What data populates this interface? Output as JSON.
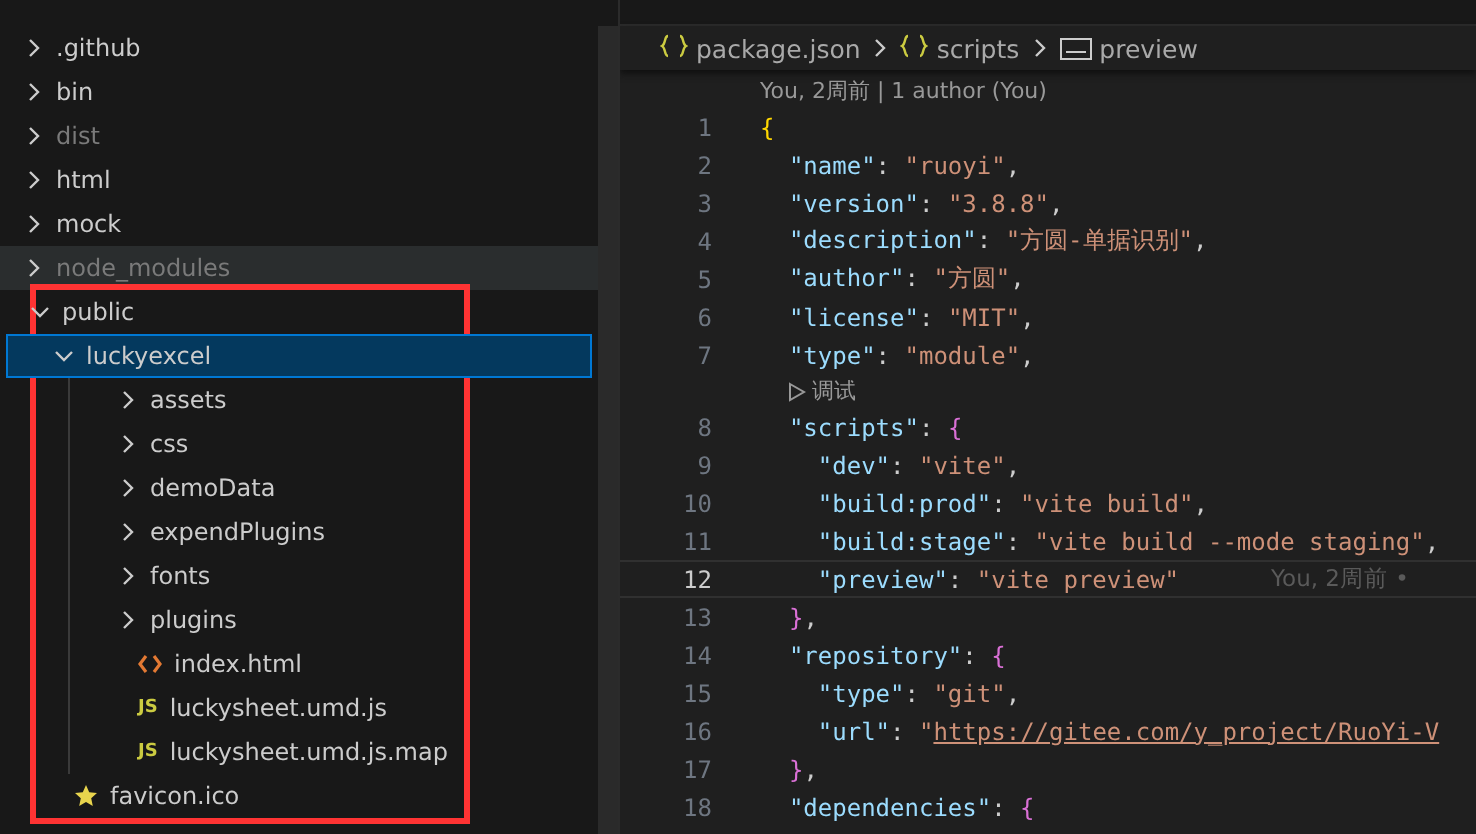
{
  "explorer": {
    "items": [
      {
        "name": ".github",
        "kind": "folder",
        "expanded": false,
        "ignored": false,
        "hovered": false,
        "selected": false,
        "outlined": false
      },
      {
        "name": "bin",
        "kind": "folder",
        "expanded": false,
        "ignored": false,
        "hovered": false,
        "selected": false,
        "outlined": false
      },
      {
        "name": "dist",
        "kind": "folder",
        "expanded": false,
        "ignored": true,
        "hovered": false,
        "selected": false,
        "outlined": false
      },
      {
        "name": "html",
        "kind": "folder",
        "expanded": false,
        "ignored": false,
        "hovered": false,
        "selected": false,
        "outlined": false
      },
      {
        "name": "mock",
        "kind": "folder",
        "expanded": false,
        "ignored": false,
        "hovered": false,
        "selected": false,
        "outlined": false
      },
      {
        "name": "node_modules",
        "kind": "folder",
        "expanded": false,
        "ignored": true,
        "hovered": true,
        "selected": false,
        "outlined": false
      },
      {
        "name": "public",
        "kind": "folder",
        "expanded": true,
        "ignored": false,
        "hovered": false,
        "selected": false,
        "outlined": true,
        "children": [
          {
            "name": "luckyexcel",
            "kind": "folder",
            "expanded": true,
            "ignored": false,
            "hovered": false,
            "selected": true,
            "outlined": false,
            "children": [
              {
                "name": "assets",
                "kind": "folder",
                "expanded": false,
                "ignored": false,
                "hovered": false,
                "selected": false,
                "outlined": false
              },
              {
                "name": "css",
                "kind": "folder",
                "expanded": false,
                "ignored": false,
                "hovered": false,
                "selected": false,
                "outlined": false
              },
              {
                "name": "demoData",
                "kind": "folder",
                "expanded": false,
                "ignored": false,
                "hovered": false,
                "selected": false,
                "outlined": false
              },
              {
                "name": "expendPlugins",
                "kind": "folder",
                "expanded": false,
                "ignored": false,
                "hovered": false,
                "selected": false,
                "outlined": false
              },
              {
                "name": "fonts",
                "kind": "folder",
                "expanded": false,
                "ignored": false,
                "hovered": false,
                "selected": false,
                "outlined": false
              },
              {
                "name": "plugins",
                "kind": "folder",
                "expanded": false,
                "ignored": false,
                "hovered": false,
                "selected": false,
                "outlined": false
              },
              {
                "name": "index.html",
                "kind": "html",
                "ignored": false,
                "hovered": false,
                "selected": false,
                "outlined": false
              },
              {
                "name": "luckysheet.umd.js",
                "kind": "js",
                "icon_text": "JS",
                "ignored": false,
                "hovered": false,
                "selected": false,
                "outlined": false
              },
              {
                "name": "luckysheet.umd.js.map",
                "kind": "js",
                "icon_text": "JS",
                "ignored": false,
                "hovered": false,
                "selected": false,
                "outlined": false
              }
            ]
          },
          {
            "name": "favicon.ico",
            "kind": "star",
            "ignored": false,
            "hovered": false,
            "selected": false,
            "outlined": false
          }
        ]
      }
    ]
  },
  "breadcrumb": [
    {
      "kind": "braces",
      "text": "package.json"
    },
    {
      "kind": "braces",
      "text": "scripts"
    },
    {
      "kind": "string",
      "text": "preview"
    }
  ],
  "editor": {
    "lines": [
      {
        "kind": "lens",
        "text": "You, 2周前 | 1 author (You)"
      },
      {
        "kind": "code",
        "number": "1",
        "current": false,
        "tokens": [
          {
            "kind": "brace1",
            "text": "{"
          }
        ]
      },
      {
        "kind": "code",
        "number": "2",
        "current": false,
        "tokens": [
          {
            "kind": "key",
            "text": "  \"name\""
          },
          {
            "kind": "punct",
            "text": ": "
          },
          {
            "kind": "str",
            "text": "\"ruoyi\""
          },
          {
            "kind": "punct",
            "text": ","
          }
        ]
      },
      {
        "kind": "code",
        "number": "3",
        "current": false,
        "tokens": [
          {
            "kind": "key",
            "text": "  \"version\""
          },
          {
            "kind": "punct",
            "text": ": "
          },
          {
            "kind": "str",
            "text": "\"3.8.8\""
          },
          {
            "kind": "punct",
            "text": ","
          }
        ]
      },
      {
        "kind": "code",
        "number": "4",
        "current": false,
        "tokens": [
          {
            "kind": "key",
            "text": "  \"description\""
          },
          {
            "kind": "punct",
            "text": ": "
          },
          {
            "kind": "str",
            "text": "\"方圆-单据识别\""
          },
          {
            "kind": "punct",
            "text": ","
          }
        ]
      },
      {
        "kind": "code",
        "number": "5",
        "current": false,
        "tokens": [
          {
            "kind": "key",
            "text": "  \"author\""
          },
          {
            "kind": "punct",
            "text": ": "
          },
          {
            "kind": "str",
            "text": "\"方圆\""
          },
          {
            "kind": "punct",
            "text": ","
          }
        ]
      },
      {
        "kind": "code",
        "number": "6",
        "current": false,
        "tokens": [
          {
            "kind": "key",
            "text": "  \"license\""
          },
          {
            "kind": "punct",
            "text": ": "
          },
          {
            "kind": "str",
            "text": "\"MIT\""
          },
          {
            "kind": "punct",
            "text": ","
          }
        ]
      },
      {
        "kind": "code",
        "number": "7",
        "current": false,
        "tokens": [
          {
            "kind": "key",
            "text": "  \"type\""
          },
          {
            "kind": "punct",
            "text": ": "
          },
          {
            "kind": "str",
            "text": "\"module\""
          },
          {
            "kind": "punct",
            "text": ","
          }
        ]
      },
      {
        "kind": "debug",
        "text": "调试"
      },
      {
        "kind": "code",
        "number": "8",
        "current": false,
        "tokens": [
          {
            "kind": "key",
            "text": "  \"scripts\""
          },
          {
            "kind": "punct",
            "text": ": "
          },
          {
            "kind": "brace2",
            "text": "{"
          }
        ]
      },
      {
        "kind": "code",
        "number": "9",
        "current": false,
        "tokens": [
          {
            "kind": "key",
            "text": "    \"dev\""
          },
          {
            "kind": "punct",
            "text": ": "
          },
          {
            "kind": "str",
            "text": "\"vite\""
          },
          {
            "kind": "punct",
            "text": ","
          }
        ]
      },
      {
        "kind": "code",
        "number": "10",
        "current": false,
        "tokens": [
          {
            "kind": "key",
            "text": "    \"build:prod\""
          },
          {
            "kind": "punct",
            "text": ": "
          },
          {
            "kind": "str",
            "text": "\"vite build\""
          },
          {
            "kind": "punct",
            "text": ","
          }
        ]
      },
      {
        "kind": "code",
        "number": "11",
        "current": false,
        "tokens": [
          {
            "kind": "key",
            "text": "    \"build:stage\""
          },
          {
            "kind": "punct",
            "text": ": "
          },
          {
            "kind": "str",
            "text": "\"vite build --mode staging\""
          },
          {
            "kind": "punct",
            "text": ","
          }
        ]
      },
      {
        "kind": "code",
        "number": "12",
        "current": true,
        "blame": "You, 2周前 •",
        "tokens": [
          {
            "kind": "key",
            "text": "    \"preview\""
          },
          {
            "kind": "punct",
            "text": ": "
          },
          {
            "kind": "str",
            "text": "\"vite preview\""
          }
        ]
      },
      {
        "kind": "code",
        "number": "13",
        "current": false,
        "tokens": [
          {
            "kind": "brace2",
            "text": "  }"
          },
          {
            "kind": "punct",
            "text": ","
          }
        ]
      },
      {
        "kind": "code",
        "number": "14",
        "current": false,
        "tokens": [
          {
            "kind": "key",
            "text": "  \"repository\""
          },
          {
            "kind": "punct",
            "text": ": "
          },
          {
            "kind": "brace2",
            "text": "{"
          }
        ]
      },
      {
        "kind": "code",
        "number": "15",
        "current": false,
        "tokens": [
          {
            "kind": "key",
            "text": "    \"type\""
          },
          {
            "kind": "punct",
            "text": ": "
          },
          {
            "kind": "str",
            "text": "\"git\""
          },
          {
            "kind": "punct",
            "text": ","
          }
        ]
      },
      {
        "kind": "code",
        "number": "16",
        "current": false,
        "tokens": [
          {
            "kind": "key",
            "text": "    \"url\""
          },
          {
            "kind": "punct",
            "text": ": "
          },
          {
            "kind": "str",
            "text": "\""
          },
          {
            "kind": "link",
            "text": "https://gitee.com/y_project/RuoYi-V"
          }
        ]
      },
      {
        "kind": "code",
        "number": "17",
        "current": false,
        "tokens": [
          {
            "kind": "brace2",
            "text": "  }"
          },
          {
            "kind": "punct",
            "text": ","
          }
        ]
      },
      {
        "kind": "code",
        "number": "18",
        "current": false,
        "tokens": [
          {
            "kind": "key",
            "text": "  \"dependencies\""
          },
          {
            "kind": "punct",
            "text": ": "
          },
          {
            "kind": "brace2",
            "text": "{"
          }
        ]
      }
    ]
  }
}
